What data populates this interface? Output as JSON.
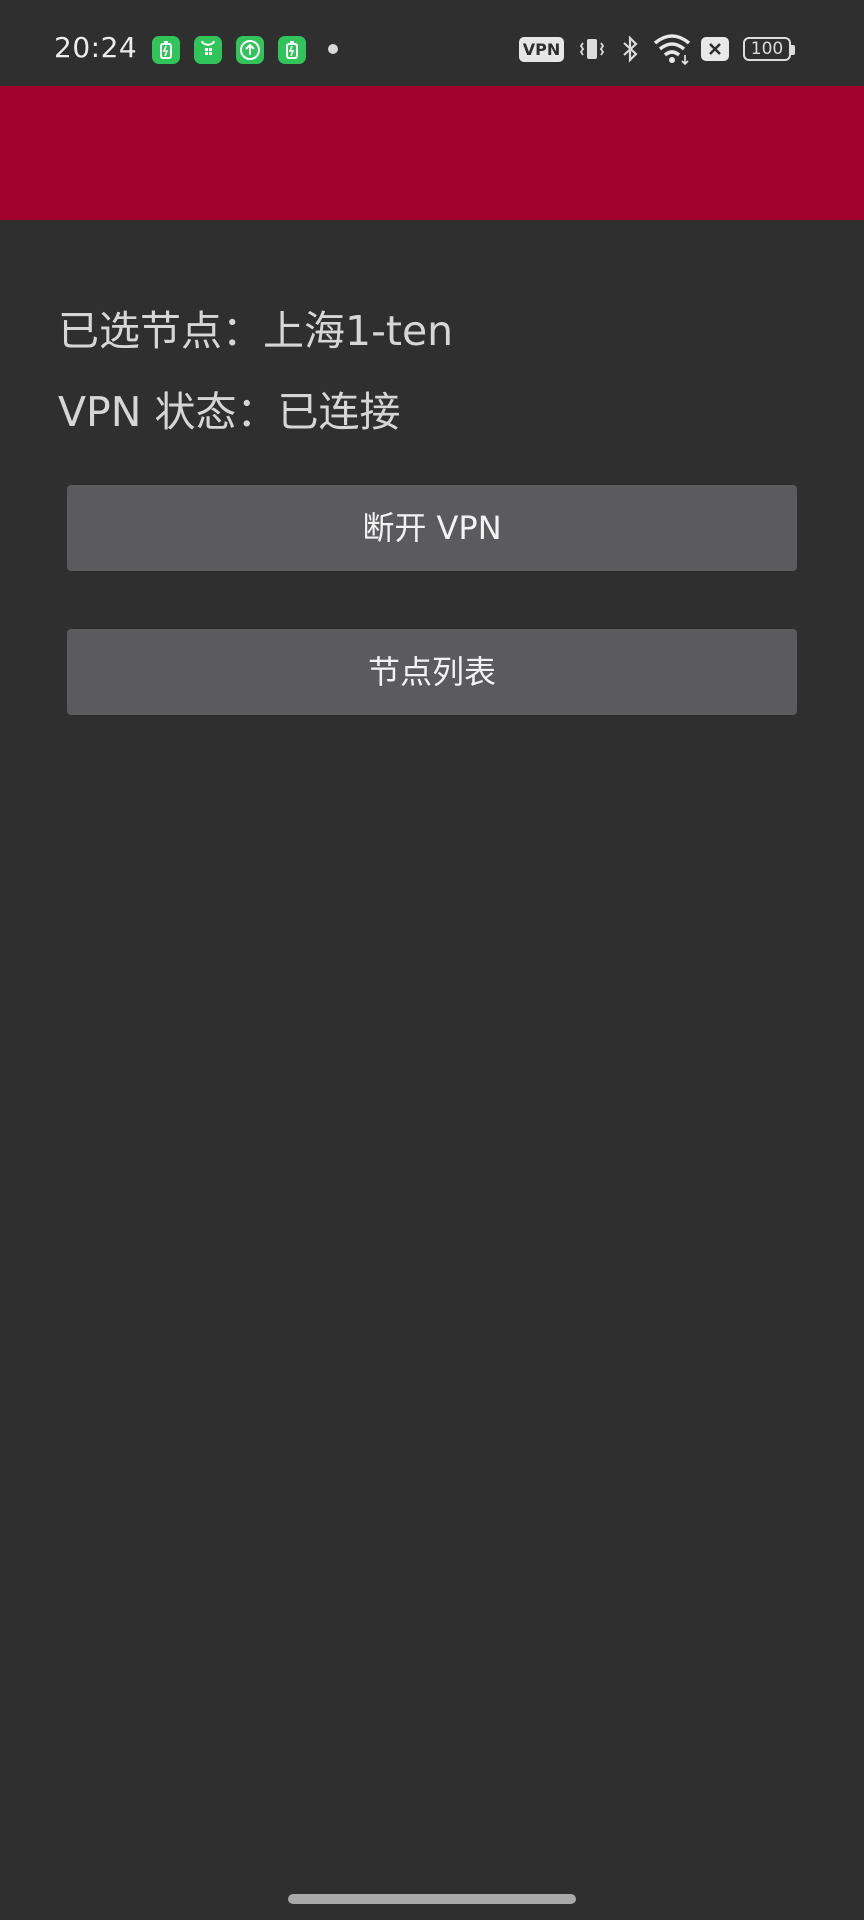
{
  "status_bar": {
    "time": "20:24",
    "notification_icons": [
      "battery-saver-icon",
      "cleaner-icon",
      "upload-icon",
      "battery-saver-icon"
    ],
    "vpn_badge": "VPN",
    "battery_level": "100",
    "system_icons": [
      "vibrate-icon",
      "bluetooth-icon",
      "wifi-icon",
      "no-sim-icon",
      "battery-icon"
    ]
  },
  "app_bar": {
    "color": "#a2012d"
  },
  "main": {
    "selected_node_label": "已选节点：",
    "selected_node_value": "上海1-ten",
    "vpn_status_label": "VPN 状态：",
    "vpn_status_value": "已连接",
    "disconnect_button": "断开 VPN",
    "node_list_button": "节点列表"
  }
}
